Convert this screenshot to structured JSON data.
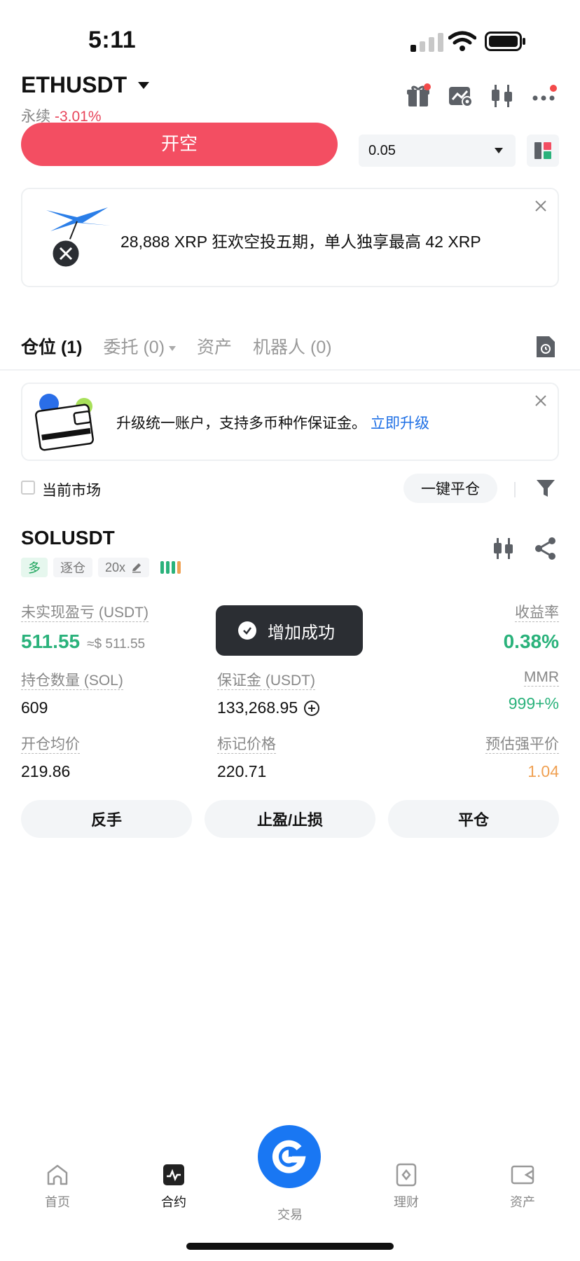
{
  "status_bar": {
    "time": "5:11"
  },
  "header": {
    "pair": "ETHUSDT",
    "contract_type": "永续",
    "change": "-3.01%"
  },
  "order": {
    "short_label": "开空",
    "quantity": "0.05"
  },
  "banner": {
    "text": "28,888 XRP 狂欢空投五期，单人独享最高 42 XRP"
  },
  "tabs": [
    {
      "label": "仓位 (1)"
    },
    {
      "label": "委托 (0)"
    },
    {
      "label": "资产"
    },
    {
      "label": "机器人 (0)"
    }
  ],
  "upgrade": {
    "text": "升级统一账户，支持多币种作保证金。",
    "link": "立即升级"
  },
  "filter": {
    "current_market_label": "当前市场",
    "close_all_label": "一键平仓"
  },
  "position": {
    "symbol": "SOLUSDT",
    "side_tag": "多",
    "margin_mode_tag": "逐仓",
    "leverage": "20x",
    "unrealized_pnl_label": "未实现盈亏 (USDT)",
    "unrealized_pnl": "511.55",
    "unrealized_pnl_usd": "≈$ 511.55",
    "roe_label": "收益率",
    "roe": "0.38%",
    "size_label": "持仓数量 (SOL)",
    "size": "609",
    "margin_label": "保证金 (USDT)",
    "margin": "133,268.95",
    "mmr_label": "MMR",
    "mmr": "999+%",
    "entry_label": "开仓均价",
    "entry": "219.86",
    "mark_label": "标记价格",
    "mark": "220.71",
    "liq_label": "预估强平价",
    "liq": "1.04",
    "buttons": {
      "reverse": "反手",
      "tpsl": "止盈/止损",
      "close": "平仓"
    }
  },
  "toast": {
    "text": "增加成功"
  },
  "nav": [
    {
      "label": "首页"
    },
    {
      "label": "合约"
    },
    {
      "label": "交易"
    },
    {
      "label": "理财"
    },
    {
      "label": "资产"
    }
  ],
  "colors": {
    "short_red": "#f34e62",
    "green": "#2ab27b",
    "orange": "#f0a153",
    "link_blue": "#1e6fe5",
    "fab_blue": "#1977f3"
  }
}
